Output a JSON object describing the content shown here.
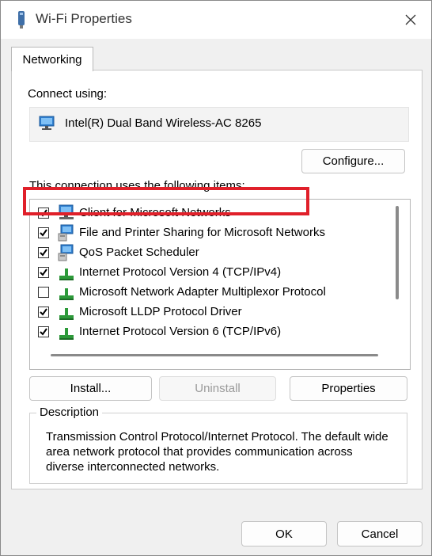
{
  "window": {
    "title": "Wi-Fi Properties"
  },
  "tabs": [
    {
      "label": "Networking"
    }
  ],
  "connect_using": {
    "label": "Connect using:",
    "adapter": "Intel(R) Dual Band Wireless-AC 8265",
    "configure_label": "Configure..."
  },
  "items_section": {
    "label": "This connection uses the following items:",
    "items": [
      {
        "label": "Client for Microsoft Networks",
        "checked": true,
        "icon": "client-network-icon"
      },
      {
        "label": "File and Printer Sharing for Microsoft Networks",
        "checked": true,
        "icon": "file-printer-sharing-icon"
      },
      {
        "label": "QoS Packet Scheduler",
        "checked": true,
        "icon": "qos-scheduler-icon"
      },
      {
        "label": "Internet Protocol Version 4 (TCP/IPv4)",
        "checked": true,
        "icon": "protocol-icon",
        "highlighted": true
      },
      {
        "label": "Microsoft Network Adapter Multiplexor Protocol",
        "checked": false,
        "icon": "protocol-icon"
      },
      {
        "label": "Microsoft LLDP Protocol Driver",
        "checked": true,
        "icon": "protocol-icon"
      },
      {
        "label": "Internet Protocol Version 6 (TCP/IPv6)",
        "checked": true,
        "icon": "protocol-icon"
      }
    ]
  },
  "buttons": {
    "install": "Install...",
    "uninstall": "Uninstall",
    "properties": "Properties",
    "ok": "OK",
    "cancel": "Cancel"
  },
  "description": {
    "title": "Description",
    "text": "Transmission Control Protocol/Internet Protocol. The default wide area network protocol that provides communication across diverse interconnected networks."
  },
  "colors": {
    "highlight_border": "#e0202a",
    "protocol_green": "#2d9a3a",
    "monitor_blue": "#2f7fd0"
  }
}
